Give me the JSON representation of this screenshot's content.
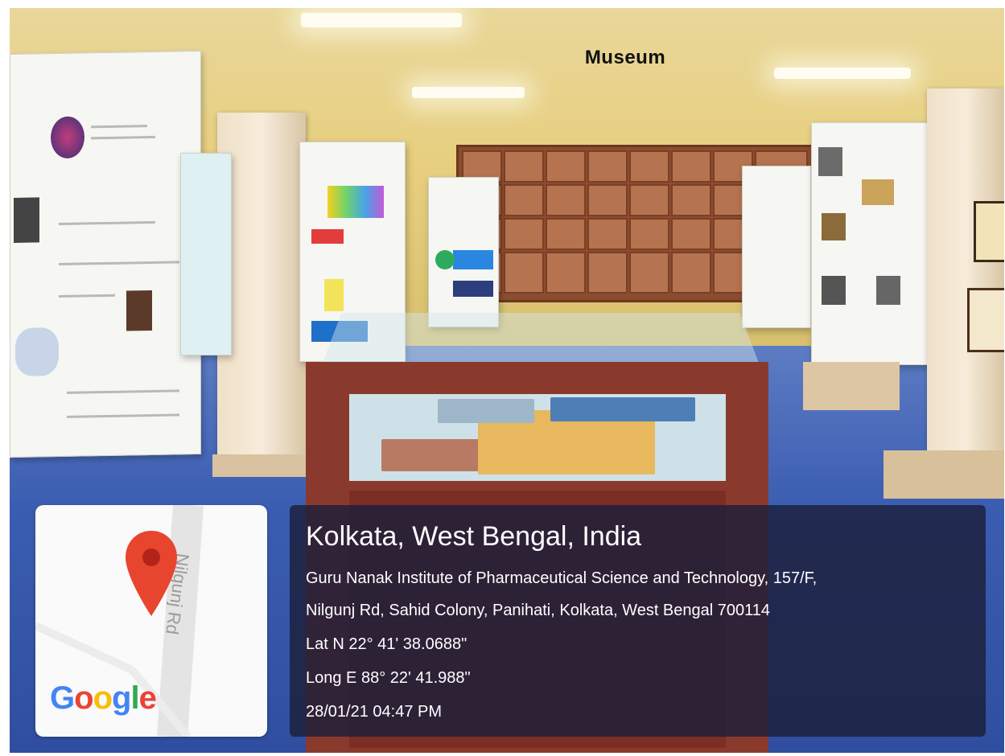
{
  "photo": {
    "title": "Museum"
  },
  "map": {
    "road_label": "Nilgunj Rd",
    "pin_color": "#e8452f",
    "icon": "map-pin-icon"
  },
  "google": {
    "letters": [
      "G",
      "o",
      "o",
      "g",
      "l",
      "e"
    ],
    "colors": [
      "#4285F4",
      "#EA4335",
      "#FBBC05",
      "#4285F4",
      "#34A853",
      "#EA4335"
    ]
  },
  "location": {
    "title": "Kolkata, West Bengal, India",
    "address_line1": "Guru Nanak Institute of Pharmaceutical Science and Technology, 157/F,",
    "address_line2": "Nilgunj Rd, Sahid Colony, Panihati, Kolkata, West Bengal 700114",
    "lat": "Lat N 22° 41' 38.0688\"",
    "long": "Long E 88° 22' 41.988\"",
    "timestamp": "28/01/21 04:47 PM"
  }
}
